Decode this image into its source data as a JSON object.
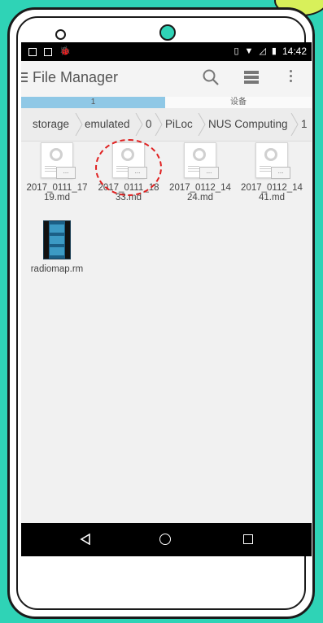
{
  "status_bar": {
    "time": "14:42",
    "icons_left": [
      "image-icon",
      "download-icon",
      "android-icon"
    ],
    "icons_right": [
      "vibrate-icon",
      "wifi-icon",
      "no-signal-icon",
      "battery-icon"
    ]
  },
  "action_bar": {
    "title": "File Manager"
  },
  "tabs": [
    {
      "label": "1"
    },
    {
      "label": "设备"
    }
  ],
  "breadcrumb": [
    "storage",
    "emulated",
    "0",
    "PiLoc",
    "NUS Computing",
    "1"
  ],
  "files": [
    {
      "name_line1": "2017_0111_17",
      "name_line2": "19.md",
      "icon": "document-icon"
    },
    {
      "name_line1": "2017_0111_18",
      "name_line2": "33.md",
      "icon": "document-icon"
    },
    {
      "name_line1": "2017_0112_14",
      "name_line2": "24.md",
      "icon": "document-icon"
    },
    {
      "name_line1": "2017_0112_14",
      "name_line2": "41.md",
      "icon": "document-icon"
    },
    {
      "name_line1": "radiomap.rm",
      "name_line2": "",
      "icon": "video-file-icon"
    }
  ],
  "doc_badge": "...",
  "colors": {
    "background": "#2fd3b6",
    "tab_active": "#8fc8e6",
    "highlight": "#e02020"
  }
}
